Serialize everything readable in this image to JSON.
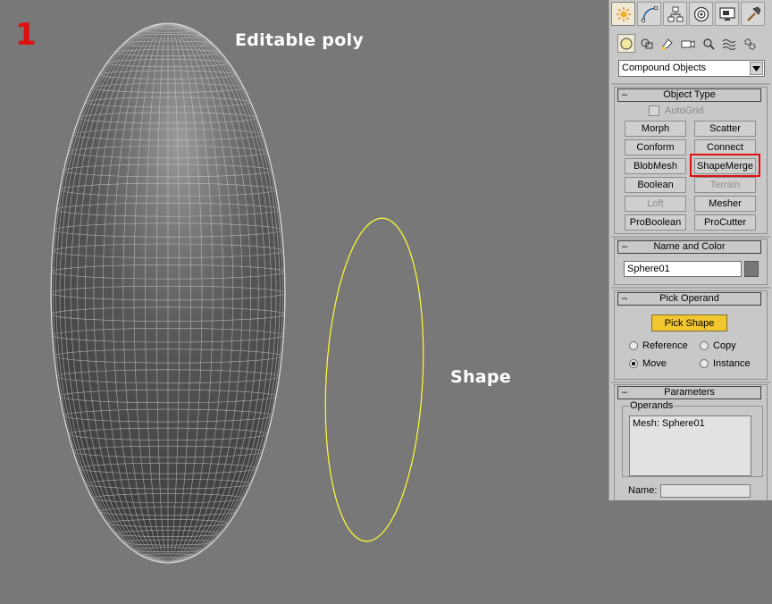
{
  "viewport": {
    "step_number": "1",
    "editable_poly_label": "Editable poly",
    "shape_label": "Shape",
    "shape_color": "#ffff33",
    "accent_red": "#e01010"
  },
  "command_panel": {
    "tabs": [
      {
        "name": "create-tab",
        "icon": "sun-icon",
        "active": true
      },
      {
        "name": "modify-tab",
        "icon": "curve-icon",
        "active": false
      },
      {
        "name": "hierarchy-tab",
        "icon": "hierarchy-icon",
        "active": false
      },
      {
        "name": "motion-tab",
        "icon": "motion-icon",
        "active": false
      },
      {
        "name": "display-tab",
        "icon": "monitor-icon",
        "active": false
      },
      {
        "name": "utilities-tab",
        "icon": "hammer-icon",
        "active": false
      }
    ],
    "category_icons": [
      "geometry-icon",
      "shapes-icon",
      "lights-icon",
      "cameras-icon",
      "helpers-icon",
      "spacewarps-icon",
      "systems-icon"
    ],
    "category_dropdown": "Compound Objects",
    "object_type": {
      "title": "Object Type",
      "autogrid_label": "AutoGrid",
      "buttons": [
        {
          "label": "Morph",
          "enabled": true
        },
        {
          "label": "Scatter",
          "enabled": true
        },
        {
          "label": "Conform",
          "enabled": true
        },
        {
          "label": "Connect",
          "enabled": true
        },
        {
          "label": "BlobMesh",
          "enabled": true
        },
        {
          "label": "ShapeMerge",
          "enabled": true,
          "highlighted": true
        },
        {
          "label": "Boolean",
          "enabled": true
        },
        {
          "label": "Terrain",
          "enabled": false
        },
        {
          "label": "Loft",
          "enabled": false
        },
        {
          "label": "Mesher",
          "enabled": true
        },
        {
          "label": "ProBoolean",
          "enabled": true
        },
        {
          "label": "ProCutter",
          "enabled": true
        }
      ]
    },
    "name_and_color": {
      "title": "Name and Color",
      "object_name": "Sphere01",
      "object_color": "#777777"
    },
    "pick_operand": {
      "title": "Pick Operand",
      "pick_button": "Pick Shape",
      "options": [
        {
          "label": "Reference",
          "selected": false
        },
        {
          "label": "Copy",
          "selected": false
        },
        {
          "label": "Move",
          "selected": true
        },
        {
          "label": "Instance",
          "selected": false
        }
      ]
    },
    "parameters": {
      "title": "Parameters",
      "operands_group": "Operands",
      "operands": [
        "Mesh: Sphere01"
      ],
      "name_label": "Name:"
    }
  }
}
